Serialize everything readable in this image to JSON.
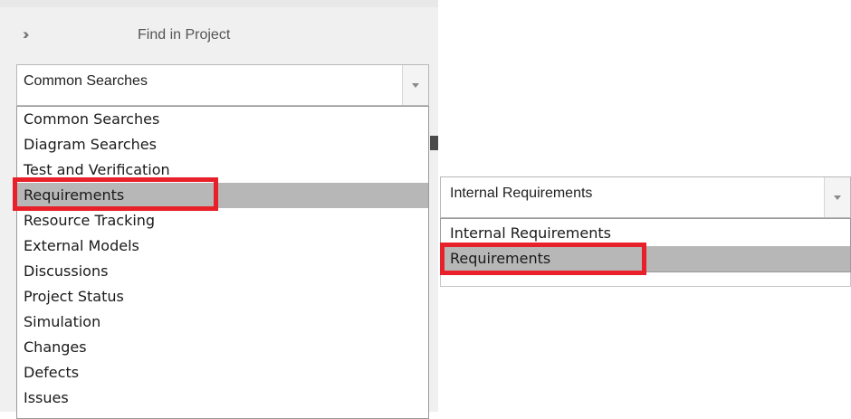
{
  "left_panel": {
    "title": "Find in Project",
    "combo_value": "Common Searches",
    "items": [
      {
        "label": "Common Searches"
      },
      {
        "label": "Diagram Searches"
      },
      {
        "label": "Test and Verification"
      },
      {
        "label": "Requirements",
        "selected": true
      },
      {
        "label": "Resource Tracking"
      },
      {
        "label": "External Models"
      },
      {
        "label": "Discussions"
      },
      {
        "label": "Project Status"
      },
      {
        "label": "Simulation"
      },
      {
        "label": "Changes"
      },
      {
        "label": "Defects"
      },
      {
        "label": "Issues"
      }
    ]
  },
  "right_panel": {
    "combo_value": "Internal Requirements",
    "items": [
      {
        "label": "Internal Requirements"
      },
      {
        "label": "Requirements",
        "selected": true
      }
    ]
  },
  "colors": {
    "highlight": "#e8202a",
    "selection": "#b7b7b7"
  },
  "icons": {
    "collapse": "double-chevron-right-icon",
    "dropdown": "chevron-down-icon"
  }
}
